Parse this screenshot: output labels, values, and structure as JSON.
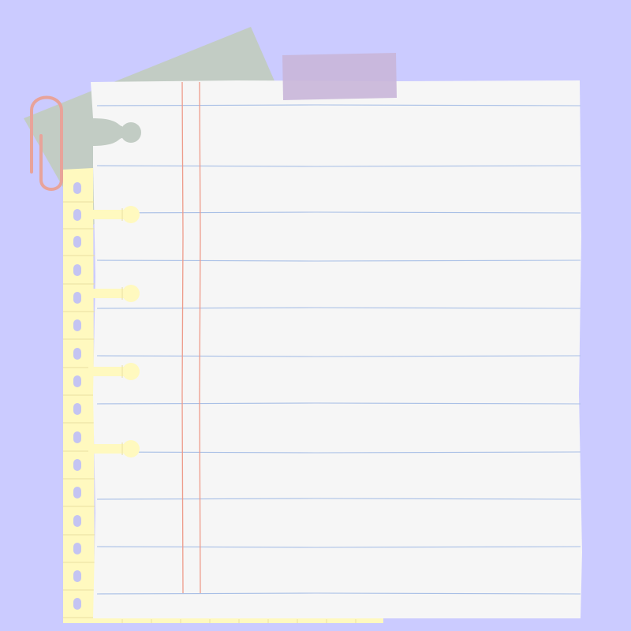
{
  "colors": {
    "background": "#CBCBFF",
    "green_paper": "#C2CCC4",
    "yellow_paper": "#FFF9BF",
    "yellow_line": "#E8DFA0",
    "white_paper": "#F6F6F6",
    "rule_line": "#A8BFE6",
    "margin_line": "#EE9B8A",
    "tape": "#C9B6D9",
    "paper_clip": "#E8A39A",
    "hole": "#C4C4F2"
  },
  "icons": [
    "paper-clip-icon",
    "washi-tape-icon"
  ]
}
